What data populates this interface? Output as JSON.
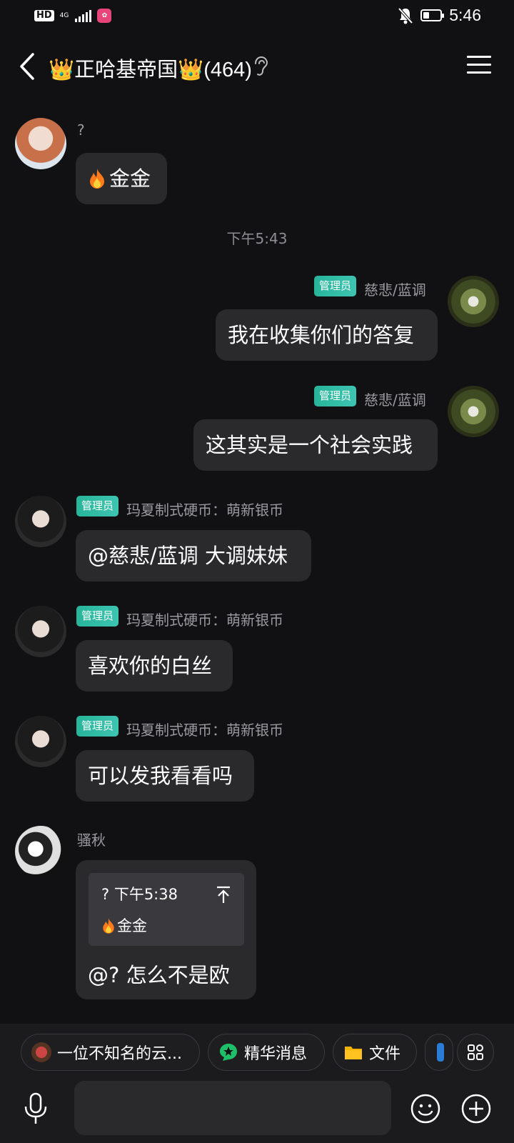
{
  "status_bar": {
    "hd": "HD",
    "network": "4G",
    "time": "5:46",
    "battery_level": 0.35
  },
  "header": {
    "title": "👑正哈基帝国👑(464)"
  },
  "messages": [
    {
      "sender": "?",
      "text": "金金"
    },
    {
      "timestamp": "下午5:43"
    },
    {
      "badge": "管理员",
      "sender": "慈悲/蓝调",
      "text": "我在收集你们的答复"
    },
    {
      "badge": "管理员",
      "sender": "慈悲/蓝调",
      "text": "这其实是一个社会实践"
    },
    {
      "badge": "管理员",
      "sender": "玛夏制式硬币：萌新银币",
      "text": "@慈悲/蓝调 大调妹妹"
    },
    {
      "badge": "管理员",
      "sender": "玛夏制式硬币：萌新银币",
      "text": "喜欢你的白丝"
    },
    {
      "badge": "管理员",
      "sender": "玛夏制式硬币：萌新银币",
      "text": "可以发我看看吗"
    },
    {
      "sender": "骚秋",
      "quote": {
        "meta": "?  下午5:38",
        "text": "金金"
      },
      "text": "@?  怎么不是欧"
    }
  ],
  "toolbar": {
    "chips": [
      {
        "label": "一位不知名的云..."
      },
      {
        "label": "精华消息"
      },
      {
        "label": "文件"
      }
    ]
  }
}
